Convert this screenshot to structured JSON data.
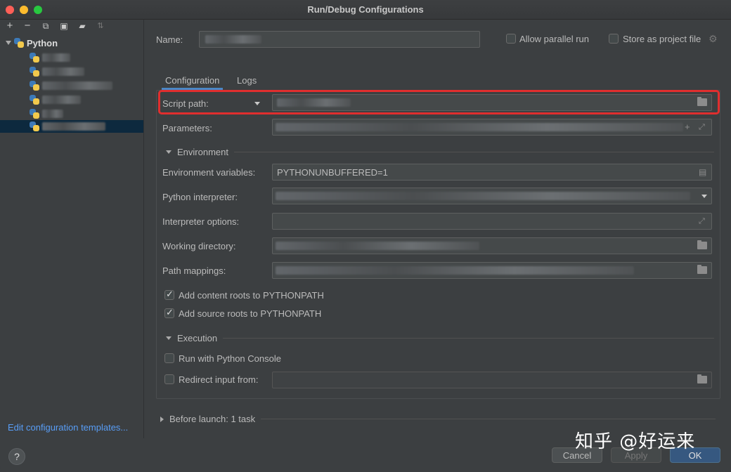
{
  "window": {
    "title": "Run/Debug Configurations"
  },
  "toolbar": {
    "icons": [
      "plus-icon",
      "minus-icon",
      "copy-icon",
      "save-icon",
      "folder-add-icon",
      "sort-icon"
    ]
  },
  "tree": {
    "root_label": "Python"
  },
  "left": {
    "edit_templates": "Edit configuration templates..."
  },
  "form": {
    "name_label": "Name:",
    "allow_parallel": "Allow parallel run",
    "store_project": "Store as project file",
    "tabs": [
      "Configuration",
      "Logs"
    ],
    "script_path_label": "Script path:",
    "parameters_label": "Parameters:",
    "environment_section": "Environment",
    "env_vars_label": "Environment variables:",
    "env_vars_value": "PYTHONUNBUFFERED=1",
    "interpreter_label": "Python interpreter:",
    "interpreter_options_label": "Interpreter options:",
    "working_dir_label": "Working directory:",
    "path_mappings_label": "Path mappings:",
    "add_content_roots": "Add content roots to PYTHONPATH",
    "add_source_roots": "Add source roots to PYTHONPATH",
    "execution_section": "Execution",
    "run_console": "Run with Python Console",
    "redirect_input": "Redirect input from:",
    "before_launch": "Before launch: 1 task"
  },
  "buttons": {
    "help": "?",
    "cancel": "Cancel",
    "apply": "Apply",
    "ok": "OK"
  },
  "watermark": "知乎 @好运来",
  "colors": {
    "highlight": "#e02e2e",
    "link": "#589df6",
    "ok_button": "#365880"
  }
}
